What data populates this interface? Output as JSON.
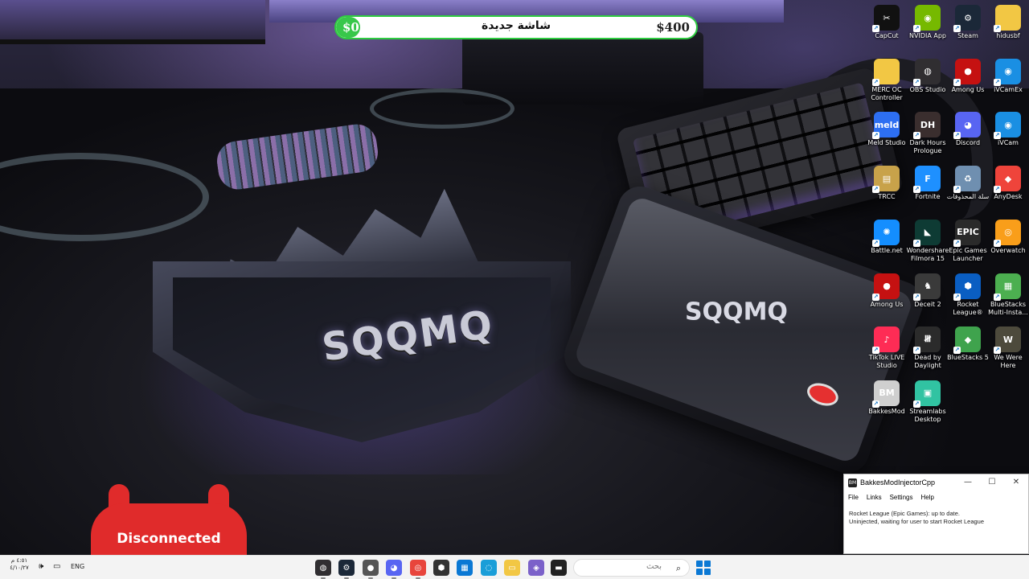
{
  "donation_bar": {
    "start_label": "$0",
    "title": "شاشة جديدة",
    "goal_label": "$400",
    "progress": 0
  },
  "desktop_icons": [
    {
      "name": "CapCut",
      "icon": "capcut-icon",
      "color": "#111111",
      "glyph": "✂"
    },
    {
      "name": "NVIDIA App",
      "icon": "nvidia-icon",
      "color": "#76b900",
      "glyph": "◉"
    },
    {
      "name": "Steam",
      "icon": "steam-icon",
      "color": "#1b2838",
      "glyph": "⚙"
    },
    {
      "name": "hidusbf",
      "icon": "folder-icon",
      "color": "#f2c744",
      "glyph": ""
    },
    {
      "name": "MERC OC Controller",
      "icon": "folder-icon",
      "color": "#f2c744",
      "glyph": ""
    },
    {
      "name": "OBS Studio",
      "icon": "obs-icon",
      "color": "#302e31",
      "glyph": "◍"
    },
    {
      "name": "Among Us",
      "icon": "among-us-icon",
      "color": "#c51111",
      "glyph": "●"
    },
    {
      "name": "iVCamEx",
      "icon": "ivcam-icon",
      "color": "#1a8fe3",
      "glyph": "◉"
    },
    {
      "name": "Meld Studio",
      "icon": "meld-icon",
      "color": "#2d6ff2",
      "glyph": "meld"
    },
    {
      "name": "Dark Hours Prologue",
      "icon": "dark-hours-icon",
      "color": "#3a2e2e",
      "glyph": "DH"
    },
    {
      "name": "Discord",
      "icon": "discord-icon",
      "color": "#5865f2",
      "glyph": "◕"
    },
    {
      "name": "iVCam",
      "icon": "ivcam-icon",
      "color": "#1a8fe3",
      "glyph": "◉"
    },
    {
      "name": "TRCC",
      "icon": "trcc-icon",
      "color": "#c8a24a",
      "glyph": "▤"
    },
    {
      "name": "Fortnite",
      "icon": "fortnite-icon",
      "color": "#1e90ff",
      "glyph": "F"
    },
    {
      "name": "سلة المحذوفات",
      "icon": "recycle-bin-icon",
      "color": "#6f8fb0",
      "glyph": "♻"
    },
    {
      "name": "AnyDesk",
      "icon": "anydesk-icon",
      "color": "#ef443b",
      "glyph": "◆"
    },
    {
      "name": "Battle.net",
      "icon": "battlenet-icon",
      "color": "#148eff",
      "glyph": "✺"
    },
    {
      "name": "Wondershare Filmora 15",
      "icon": "filmora-icon",
      "color": "#0e3b34",
      "glyph": "◣"
    },
    {
      "name": "Epic Games Launcher",
      "icon": "epic-games-icon",
      "color": "#2a2a2a",
      "glyph": "EPIC"
    },
    {
      "name": "Overwatch",
      "icon": "overwatch-icon",
      "color": "#f99e1a",
      "glyph": "◎"
    },
    {
      "name": "Among Us",
      "icon": "among-us-icon",
      "color": "#c51111",
      "glyph": "●"
    },
    {
      "name": "Deceit 2",
      "icon": "deceit-icon",
      "color": "#3a3a3a",
      "glyph": "♞"
    },
    {
      "name": "Rocket League®",
      "icon": "rocket-league-icon",
      "color": "#0a5ec2",
      "glyph": "⬢"
    },
    {
      "name": "BlueStacks Multi-Insta...",
      "icon": "bluestacks-multi-icon",
      "color": "#4caf50",
      "glyph": "▦"
    },
    {
      "name": "TikTok LIVE Studio",
      "icon": "tiktok-icon",
      "color": "#fe2c55",
      "glyph": "♪"
    },
    {
      "name": "Dead by Daylight",
      "icon": "dead-by-daylight-icon",
      "color": "#2b2b2b",
      "glyph": "𝍸"
    },
    {
      "name": "BlueStacks 5",
      "icon": "bluestacks-icon",
      "color": "#3fa34d",
      "glyph": "◆"
    },
    {
      "name": "We Were Here",
      "icon": "we-were-here-icon",
      "color": "#4d4a3c",
      "glyph": "W"
    },
    {
      "name": "BakkesMod",
      "icon": "bakkesmod-icon",
      "color": "#cfcfcf",
      "glyph": "BM"
    },
    {
      "name": "Streamlabs Desktop",
      "icon": "streamlabs-icon",
      "color": "#31c3a2",
      "glyph": "▣"
    }
  ],
  "controller_overlay": {
    "status": "Disconnected",
    "color": "#e02b2b"
  },
  "injector_window": {
    "title": "BakkesModInjectorCpp",
    "icon_label": "BM",
    "menu": [
      "File",
      "Links",
      "Settings",
      "Help"
    ],
    "log_lines": [
      "Rocket League (Epic Games): up to date.",
      "Uninjected, waiting for user to start Rocket League"
    ],
    "controls": [
      "—",
      "☐",
      "✕"
    ]
  },
  "taskbar": {
    "search_placeholder": "بحث",
    "apps": [
      {
        "name": "OBS Studio",
        "icon": "obs-icon",
        "color": "#302e31",
        "glyph": "◍"
      },
      {
        "name": "Steam",
        "icon": "steam-icon",
        "color": "#1b2838",
        "glyph": "⚙"
      },
      {
        "name": "Among Us",
        "icon": "among-us-icon",
        "color": "#555555",
        "glyph": "●"
      },
      {
        "name": "Discord",
        "icon": "discord-icon",
        "color": "#5865f2",
        "glyph": "◕"
      },
      {
        "name": "Google Chrome",
        "icon": "chrome-icon",
        "color": "#e8453c",
        "glyph": "◎"
      },
      {
        "name": "Unknown App",
        "icon": "cube-icon",
        "color": "#333333",
        "glyph": "⬢"
      },
      {
        "name": "Microsoft Store",
        "icon": "store-icon",
        "color": "#0a78d4",
        "glyph": "▦"
      },
      {
        "name": "Microsoft Edge",
        "icon": "edge-icon",
        "color": "#1a9ed8",
        "glyph": "◌"
      },
      {
        "name": "File Explorer",
        "icon": "folder-icon",
        "color": "#f2c744",
        "glyph": "▭"
      },
      {
        "name": "Photos",
        "icon": "photos-icon",
        "color": "#7b61c9",
        "glyph": "◈"
      },
      {
        "name": "Terminal",
        "icon": "window-icon",
        "color": "#222222",
        "glyph": "▬"
      }
    ],
    "tray": {
      "language": "ENG",
      "time": "٤:٥١ م",
      "date": "٤/١٠/٢٧"
    }
  }
}
